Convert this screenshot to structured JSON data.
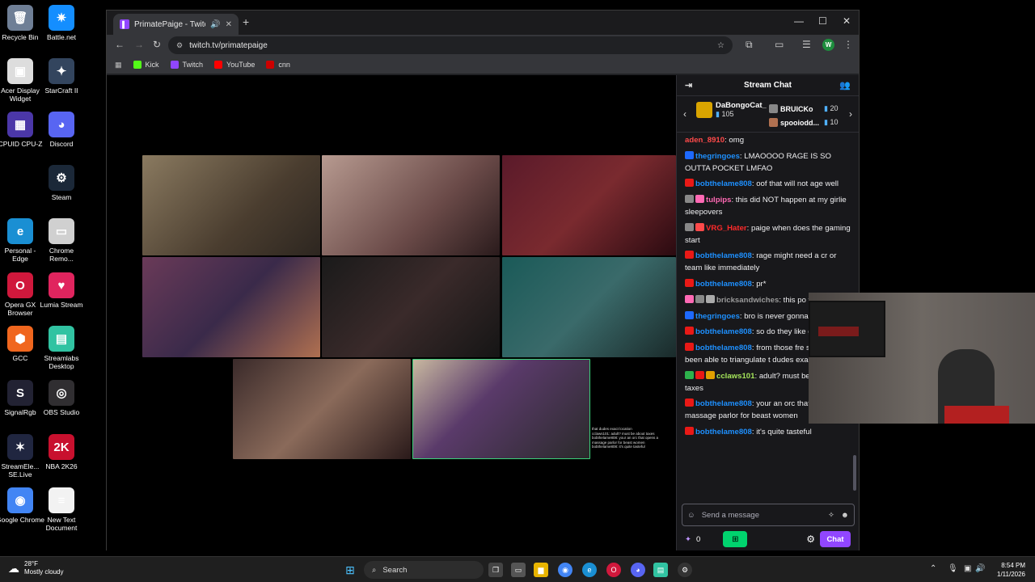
{
  "desktop": {
    "icons": [
      {
        "label": "Recycle Bin",
        "color": "#6f7f96",
        "glyph": "🗑"
      },
      {
        "label": "Battle.net",
        "color": "#148eff",
        "glyph": "✷"
      },
      {
        "label": "Acer Display Widget",
        "color": "#dddddd",
        "glyph": "▣"
      },
      {
        "label": "StarCraft II",
        "color": "#33455e",
        "glyph": "✦"
      },
      {
        "label": "CPUID CPU-Z",
        "color": "#4b37a8",
        "glyph": "▦"
      },
      {
        "label": "Discord",
        "color": "#5865f2",
        "glyph": "◕"
      },
      {
        "label": "Steam",
        "color": "#1b2838",
        "glyph": "⚙"
      },
      {
        "label": "Personal - Edge",
        "color": "#1a8fd3",
        "glyph": "e"
      },
      {
        "label": "Chrome Remo...",
        "color": "#d0d0d0",
        "glyph": "▭"
      },
      {
        "label": "Opera GX Browser",
        "color": "#d0183c",
        "glyph": "O"
      },
      {
        "label": "Lumia Stream",
        "color": "#e0245e",
        "glyph": "♥"
      },
      {
        "label": "GCC",
        "color": "#f0661e",
        "glyph": "⬢"
      },
      {
        "label": "Streamlabs Desktop",
        "color": "#31c3a2",
        "glyph": "▤"
      },
      {
        "label": "SignalRgb",
        "color": "#222233",
        "glyph": "S"
      },
      {
        "label": "OBS Studio",
        "color": "#302e31",
        "glyph": "◎"
      },
      {
        "label": "StreamEle... SE.Live",
        "color": "#202640",
        "glyph": "✶"
      },
      {
        "label": "NBA 2K26",
        "color": "#c8102e",
        "glyph": "2K"
      },
      {
        "label": "Google Chrome",
        "color": "#4285f4",
        "glyph": "◉"
      },
      {
        "label": "New Text Document",
        "color": "#f2f2f2",
        "glyph": "≡"
      }
    ]
  },
  "browser": {
    "tab_title": "PrimatePaige - Twitch",
    "url": "twitch.tv/primatepaige",
    "profile_initial": "W",
    "bookmarks": [
      {
        "label": "Kick",
        "color": "#53fc18"
      },
      {
        "label": "Twitch",
        "color": "#9146ff"
      },
      {
        "label": "YouTube",
        "color": "#ff0000"
      },
      {
        "label": "cnn",
        "color": "#cc0000"
      }
    ]
  },
  "video": {
    "overlay_chat": [
      "that dudes exact location",
      "cclaws101: adult? must be about taxes",
      "bobthelame808: your an orc that opens a massage parlor for beast women",
      "bobthelame808: it's quite tasteful"
    ]
  },
  "chat": {
    "title": "Stream Chat",
    "gifters": {
      "top": {
        "name": "DaBongoCat_",
        "count": "105"
      },
      "second": [
        {
          "name": "BRUICKo",
          "count": "20"
        },
        {
          "name": "spooiodd...",
          "count": "10"
        }
      ]
    },
    "messages": [
      {
        "user": "aden_8910",
        "color": "#ff4a4a",
        "text": "omg",
        "badges": []
      },
      {
        "user": "thegringoes",
        "color": "#1e90ff",
        "text": "LMAOOOO RAGE IS SO OUTTA POCKET LMFAO",
        "badges": [
          "#1e69ff"
        ]
      },
      {
        "user": "bobthelame808",
        "color": "#1e90ff",
        "text": "oof that will not age well",
        "badges": [
          "#e91916"
        ]
      },
      {
        "user": "tulpips",
        "color": "#ff69b4",
        "text": "this did NOT happen at my girlie sleepovers",
        "badges": [
          "#888888",
          "#ff69b4"
        ]
      },
      {
        "user": "VRG_Hater",
        "color": "#ff2a2a",
        "text": "paige when does the gaming start",
        "badges": [
          "#888888",
          "#ff4a4a"
        ]
      },
      {
        "user": "bobthelame808",
        "color": "#1e90ff",
        "text": "rage might need a cr or team like immediately",
        "badges": [
          "#e91916"
        ]
      },
      {
        "user": "bobthelame808",
        "color": "#1e90ff",
        "text": "pr*",
        "badges": [
          "#e91916"
        ]
      },
      {
        "user": "bricksandwiches",
        "color": "#9a9a9a",
        "text": "this po fire",
        "badges": [
          "#ff69b4",
          "#888888",
          "#aaaaaa"
        ]
      },
      {
        "user": "thegringoes",
        "color": "#1e90ff",
        "text": "bro is never gonna home",
        "badges": [
          "#1e69ff"
        ]
      },
      {
        "user": "bobthelame808",
        "color": "#1e90ff",
        "text": "so do they like games?",
        "badges": [
          "#e91916"
        ]
      },
      {
        "user": "bobthelame808",
        "color": "#1e90ff",
        "text": "from those fre signs I've been able to triangulate t dudes exact location",
        "badges": [
          "#e91916"
        ]
      },
      {
        "user": "cclaws101",
        "color": "#a4e45a",
        "text": "adult? must be about taxes",
        "badges": [
          "#2db24c",
          "#e91916",
          "#e0a000"
        ]
      },
      {
        "user": "bobthelame808",
        "color": "#1e90ff",
        "text": "your an orc that opens a massage parlor for beast women",
        "badges": [
          "#e91916"
        ]
      },
      {
        "user": "bobthelame808",
        "color": "#1e90ff",
        "text": "it's quite tasteful",
        "badges": [
          "#e91916"
        ]
      }
    ],
    "composer_placeholder": "Send a message",
    "points": "0",
    "chat_button": "Chat"
  },
  "taskbar": {
    "weather_temp": "28°F",
    "weather_desc": "Mostly cloudy",
    "search_label": "Search",
    "time": "8:54 PM",
    "date": "1/11/2026"
  }
}
